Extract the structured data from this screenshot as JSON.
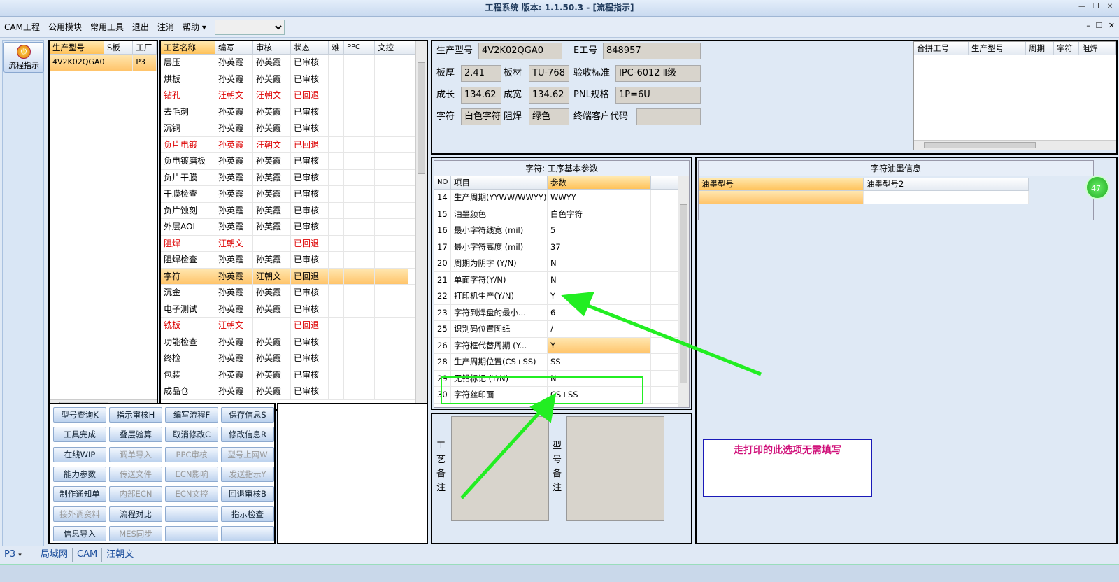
{
  "window": {
    "title": "工程系统  版本: 1.1.50.3 - [流程指示]"
  },
  "menu": {
    "items": [
      "CAM工程",
      "公用模块",
      "常用工具",
      "退出",
      "注消",
      "帮助"
    ],
    "help_arrow": "▾"
  },
  "left": {
    "flow_label": "流程指示"
  },
  "model_grid": {
    "headers": [
      "生产型号",
      "S板",
      "工厂"
    ],
    "rows": [
      [
        "4V2K02QGA0",
        "",
        "P3"
      ]
    ]
  },
  "process_grid": {
    "headers": [
      "工艺名称",
      "编写",
      "审核",
      "状态",
      "难",
      "PPC",
      "文控"
    ],
    "rows": [
      {
        "cells": [
          "层压",
          "孙英霞",
          "孙英霞",
          "已审核"
        ],
        "red": false
      },
      {
        "cells": [
          "烘板",
          "孙英霞",
          "孙英霞",
          "已审核"
        ],
        "red": false
      },
      {
        "cells": [
          "钻孔",
          "汪朝文",
          "汪朝文",
          "已回退"
        ],
        "red": true
      },
      {
        "cells": [
          "去毛刺",
          "孙英霞",
          "孙英霞",
          "已审核"
        ],
        "red": false
      },
      {
        "cells": [
          "沉铜",
          "孙英霞",
          "孙英霞",
          "已审核"
        ],
        "red": false
      },
      {
        "cells": [
          "负片电镀",
          "孙英霞",
          "汪朝文",
          "已回退"
        ],
        "red": true
      },
      {
        "cells": [
          "负电镀磨板",
          "孙英霞",
          "孙英霞",
          "已审核"
        ],
        "red": false
      },
      {
        "cells": [
          "负片干膜",
          "孙英霞",
          "孙英霞",
          "已审核"
        ],
        "red": false
      },
      {
        "cells": [
          "干膜检查",
          "孙英霞",
          "孙英霞",
          "已审核"
        ],
        "red": false
      },
      {
        "cells": [
          "负片蚀刻",
          "孙英霞",
          "孙英霞",
          "已审核"
        ],
        "red": false
      },
      {
        "cells": [
          "外层AOI",
          "孙英霞",
          "孙英霞",
          "已审核"
        ],
        "red": false
      },
      {
        "cells": [
          "阻焊",
          "汪朝文",
          "",
          "已回退"
        ],
        "red": true
      },
      {
        "cells": [
          "阻焊检查",
          "孙英霞",
          "孙英霞",
          "已审核"
        ],
        "red": false
      },
      {
        "cells": [
          "字符",
          "孙英霞",
          "汪朝文",
          "已回退"
        ],
        "red": false,
        "selected": true
      },
      {
        "cells": [
          "沉金",
          "孙英霞",
          "孙英霞",
          "已审核"
        ],
        "red": false
      },
      {
        "cells": [
          "电子测试",
          "孙英霞",
          "孙英霞",
          "已审核"
        ],
        "red": false
      },
      {
        "cells": [
          "铣板",
          "汪朝文",
          "",
          "已回退"
        ],
        "red": true
      },
      {
        "cells": [
          "功能检查",
          "孙英霞",
          "孙英霞",
          "已审核"
        ],
        "red": false
      },
      {
        "cells": [
          "终检",
          "孙英霞",
          "孙英霞",
          "已审核"
        ],
        "red": false
      },
      {
        "cells": [
          "包装",
          "孙英霞",
          "孙英霞",
          "已审核"
        ],
        "red": false
      },
      {
        "cells": [
          "成品仓",
          "孙英霞",
          "孙英霞",
          "已审核"
        ],
        "red": false
      }
    ]
  },
  "buttons": [
    {
      "label": "型号查询K",
      "enabled": true
    },
    {
      "label": "指示审核H",
      "enabled": true
    },
    {
      "label": "编写流程F",
      "enabled": true
    },
    {
      "label": "保存信息S",
      "enabled": true
    },
    {
      "label": "工具完成",
      "enabled": true
    },
    {
      "label": "叠层验算",
      "enabled": true
    },
    {
      "label": "取消修改C",
      "enabled": true
    },
    {
      "label": "修改信息R",
      "enabled": true
    },
    {
      "label": "在线WIP",
      "enabled": true
    },
    {
      "label": "调单导入",
      "enabled": false
    },
    {
      "label": "PPC审核",
      "enabled": false
    },
    {
      "label": "型号上网W",
      "enabled": false
    },
    {
      "label": "能力参数",
      "enabled": true
    },
    {
      "label": "传送文件",
      "enabled": false
    },
    {
      "label": "ECN影响",
      "enabled": false
    },
    {
      "label": "发送指示Y",
      "enabled": false
    },
    {
      "label": "制作通知单",
      "enabled": true
    },
    {
      "label": "内部ECN",
      "enabled": false
    },
    {
      "label": "ECN文控",
      "enabled": false
    },
    {
      "label": "回退审核B",
      "enabled": true
    },
    {
      "label": "接外调资料",
      "enabled": false
    },
    {
      "label": "流程对比",
      "enabled": true
    },
    {
      "label": "",
      "enabled": true
    },
    {
      "label": "指示检查",
      "enabled": true
    },
    {
      "label": "信息导入",
      "enabled": true
    },
    {
      "label": "MES同步",
      "enabled": false
    },
    {
      "label": "",
      "enabled": true
    },
    {
      "label": "",
      "enabled": true
    }
  ],
  "info": {
    "model_label": "生产型号",
    "model_value": "4V2K02QGA0",
    "eno_label": "E工号",
    "eno_value": "848957",
    "thick_label": "板厚",
    "thick_value": "2.41",
    "mat_label": "板材",
    "mat_value": "TU-768",
    "std_label": "验收标准",
    "std_value": "IPC-6012 Ⅱ级",
    "len_label": "成长",
    "len_value": "134.62",
    "wid_label": "成宽",
    "wid_value": "134.62",
    "pnl_label": "PNL规格",
    "pnl_value": "1P=6U",
    "char_label": "字符",
    "char_value": "白色字符",
    "mask_label": "阻焊",
    "mask_value": "绿色",
    "cust_label": "终端客户代码",
    "cust_value": ""
  },
  "merge_grid": {
    "headers": [
      "合拼工号",
      "生产型号",
      "周期",
      "字符",
      "阻焊"
    ]
  },
  "params": {
    "title": "字符: 工序基本参数",
    "headers": [
      "NO",
      "项目",
      "参数"
    ],
    "rows": [
      [
        "14",
        "生产周期(YYWW/WWYY)",
        "WWYY"
      ],
      [
        "15",
        "油墨颜色",
        "白色字符"
      ],
      [
        "16",
        "最小字符线宽 (mil)",
        "5"
      ],
      [
        "17",
        "最小字符高度 (mil)",
        "37"
      ],
      [
        "20",
        "周期为阴字 (Y/N)",
        "N"
      ],
      [
        "21",
        "单面字符(Y/N)",
        "N"
      ],
      [
        "22",
        "打印机生产(Y/N)",
        "Y"
      ],
      [
        "23",
        "字符到焊盘的最小...",
        "6"
      ],
      [
        "25",
        "识别码位置图纸",
        "/"
      ],
      [
        "26",
        "字符框代替周期 (Y...",
        "Y"
      ],
      [
        "28",
        "生产周期位置(CS+SS)",
        "SS"
      ],
      [
        "29",
        "无铅标记 (Y/N)",
        "N"
      ],
      [
        "30",
        "字符丝印面",
        "CS+SS"
      ]
    ]
  },
  "ink": {
    "title": "字符油墨信息",
    "headers": [
      "油墨型号",
      "油墨型号2"
    ]
  },
  "notes": {
    "process_label": "工艺备注",
    "model_label": "型号备注"
  },
  "annotation": {
    "text": "走打印的此选项无需填写",
    "badge": "47"
  },
  "status": {
    "factory": "P3",
    "items": [
      "局域网",
      "CAM",
      "汪朝文"
    ]
  },
  "colors": {
    "accent_green": "#22ee22",
    "annotation_text": "#d0107a",
    "annotation_border": "#1a1ab8",
    "red_text": "#dd0000"
  }
}
